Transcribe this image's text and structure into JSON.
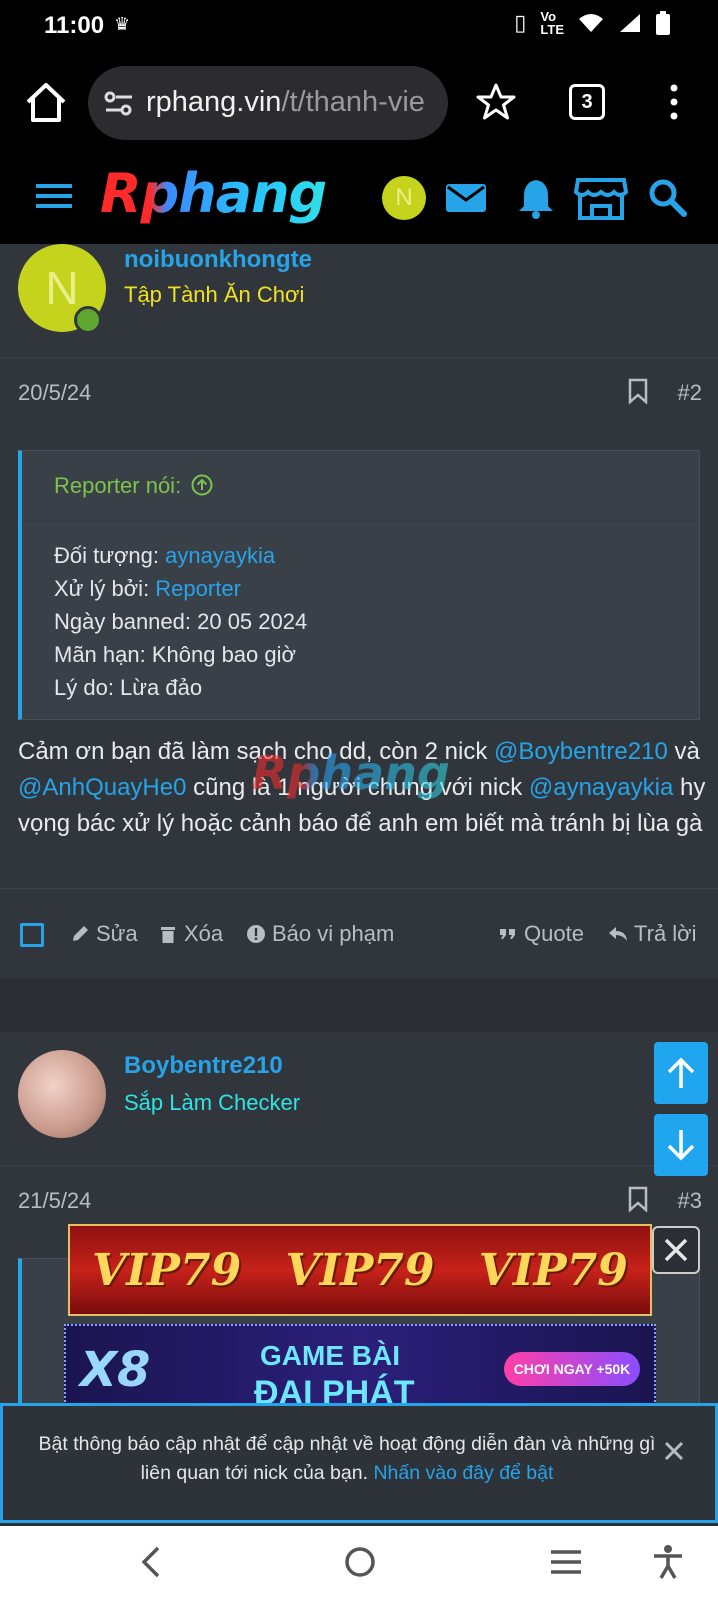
{
  "status_bar": {
    "time": "11:00"
  },
  "browser": {
    "url_host": "rphang.vin",
    "url_path": "/t/thanh-vie",
    "tab_count": "3"
  },
  "header": {
    "logo": "Rphang",
    "avatar_letter": "N"
  },
  "posts": [
    {
      "avatar_letter": "N",
      "username": "noibuonkhongte",
      "user_title": "Tập Tành Ăn Chơi",
      "user_title_color": "#f0e21c",
      "date": "20/5/24",
      "number": "#2",
      "quote": {
        "author": "Reporter nói:",
        "lines": [
          {
            "label": "Đối tượng: ",
            "value": "aynayaykia"
          },
          {
            "label": "Xử lý bởi: ",
            "value": "Reporter"
          },
          {
            "label": "Ngày banned: 20 05 2024"
          },
          {
            "label": "Mãn hạn: Không bao giờ"
          },
          {
            "label": "Lý do: Lừa đảo"
          }
        ]
      },
      "body": {
        "t1": "Cảm ơn bạn đã làm sạch cho dd, còn 2 nick ",
        "m1": "@Boybentre210",
        "t2": " và ",
        "m2": "@AnhQuayHe0",
        "t3": " cũng là 1 người chung với nick ",
        "m3": "@aynayaykia",
        "t4": " hy vọng bác xử lý hoặc cảnh báo để anh em biết mà tránh bị lùa gà"
      },
      "watermark": "Rphang",
      "actions": {
        "edit": "Sửa",
        "delete": "Xóa",
        "report": "Báo vi phạm",
        "quote": "Quote",
        "reply": "Trả lời"
      }
    },
    {
      "username": "Boybentre210",
      "user_title": "Sắp Làm Checker",
      "user_title_color": "#2ee3e3",
      "date": "21/5/24",
      "number": "#3"
    }
  ],
  "ads": {
    "ad1_text": [
      "VIP79",
      "VIP79",
      "VIP79"
    ],
    "ad2_logo": "X8",
    "ad2_line1": "GAME BÀI",
    "ad2_line2": "ĐẠI PHÁT",
    "ad2_pill": "CHƠI NGAY +50K"
  },
  "notice": {
    "text": "Bật thông báo cập nhật để cập nhật về hoạt động diễn đàn và những gì liên quan tới nick của bạn. ",
    "link": "Nhấn vào đây để bật"
  },
  "colors": {
    "accent": "#27a3e8",
    "background": "#2b2f35",
    "post": "#31363d"
  }
}
